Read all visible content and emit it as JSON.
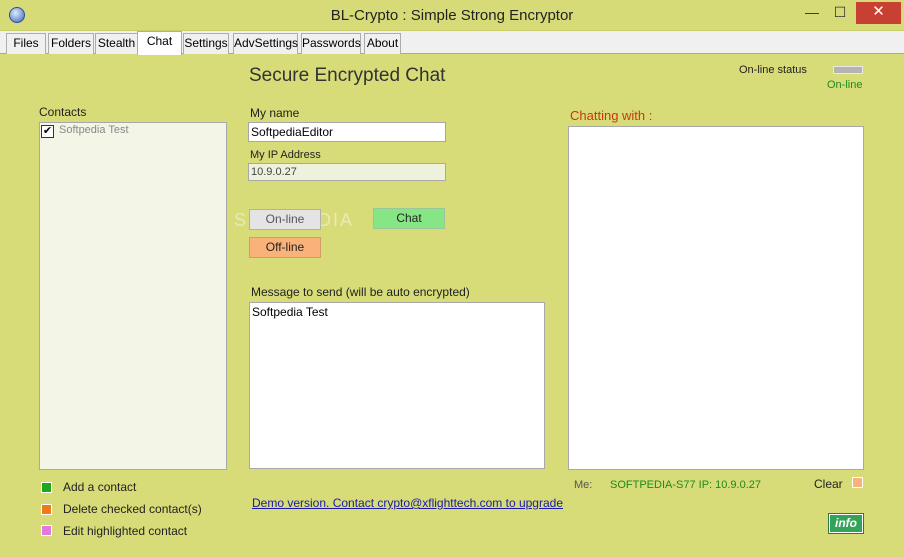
{
  "window": {
    "title": "BL-Crypto : Simple Strong Encryptor",
    "min_glyph": "—",
    "max_glyph": "☐",
    "close_glyph": "✕"
  },
  "tabs": [
    {
      "label": "Files"
    },
    {
      "label": "Folders"
    },
    {
      "label": "Stealth"
    },
    {
      "label": "Chat",
      "active": true
    },
    {
      "label": "Settings"
    },
    {
      "label": "AdvSettings"
    },
    {
      "label": "Passwords"
    },
    {
      "label": "About"
    }
  ],
  "chat": {
    "heading": "Secure Encrypted Chat",
    "online_status_label": "On-line status",
    "online_status_value": "On-line",
    "contacts_label": "Contacts",
    "contacts": [
      {
        "name": "Softpedia Test",
        "checked": true,
        "check_glyph": "✔"
      }
    ],
    "my_name_label": "My name",
    "my_name_value": "SoftpediaEditor",
    "my_ip_label": "My IP Address",
    "my_ip_value": "10.9.0.27",
    "online_button": "On-line",
    "chat_button": "Chat",
    "offline_button": "Off-line",
    "message_label": "Message to send (will be auto encrypted)",
    "message_value": "Softpedia Test",
    "chatting_with_label": "Chatting with :",
    "me_label": "Me:",
    "me_value": "SOFTPEDIA-S77 IP: 10.9.0.27",
    "clear_label": "Clear",
    "add_contact": "Add a contact",
    "delete_contacts": "Delete checked contact(s)",
    "edit_contact": "Edit highlighted contact",
    "demo_link": "Demo version. Contact crypto@xflighttech.com to upgrade",
    "info_button": "info",
    "watermark": "SOFTPEDIA"
  },
  "colors": {
    "background": "#d7db78",
    "chat_button": "#86e686",
    "offline_button": "#f8b27a",
    "add_square": "#1fa51f",
    "delete_square": "#f07a1a",
    "edit_square": "#e07ae0",
    "chatting_with_text": "#c83a0a",
    "status_text": "#1e8a1e"
  }
}
